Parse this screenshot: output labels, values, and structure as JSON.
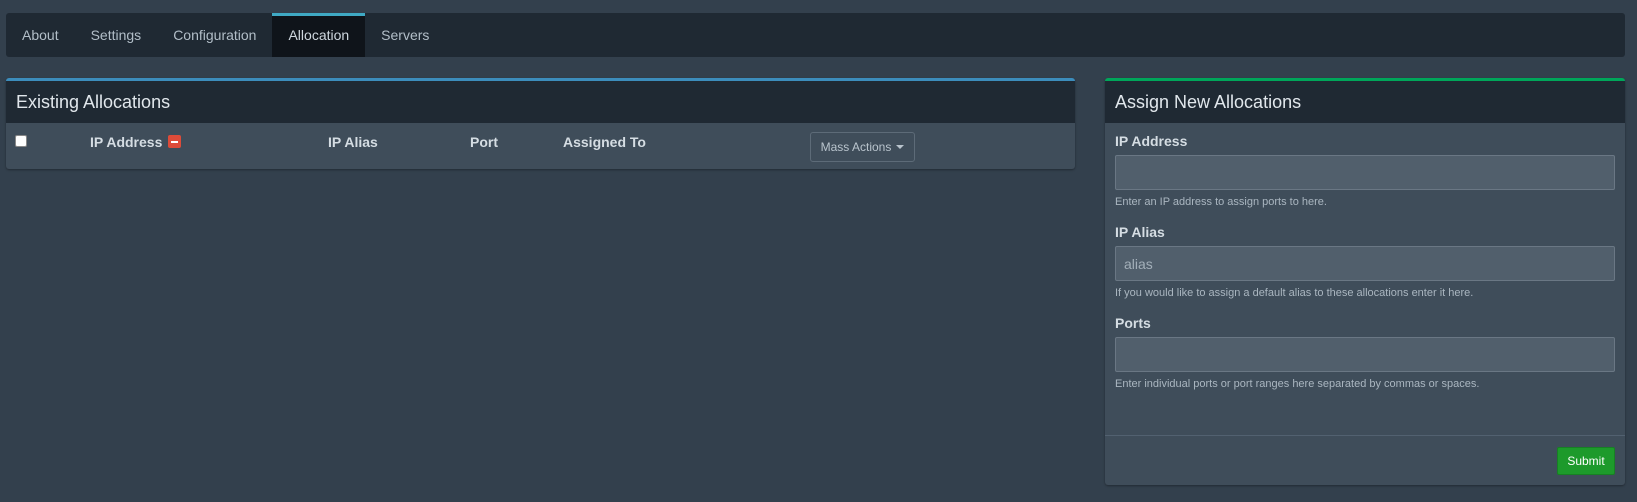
{
  "tabs": [
    {
      "label": "About"
    },
    {
      "label": "Settings"
    },
    {
      "label": "Configuration"
    },
    {
      "label": "Allocation",
      "active": true
    },
    {
      "label": "Servers"
    }
  ],
  "existing": {
    "title": "Existing Allocations",
    "columns": {
      "ip_address": "IP Address",
      "ip_alias": "IP Alias",
      "port": "Port",
      "assigned_to": "Assigned To"
    },
    "mass_actions_label": "Mass Actions",
    "rows": []
  },
  "assign": {
    "title": "Assign New Allocations",
    "ip_address": {
      "label": "IP Address",
      "value": "",
      "help": "Enter an IP address to assign ports to here."
    },
    "ip_alias": {
      "label": "IP Alias",
      "placeholder": "alias",
      "help": "If you would like to assign a default alias to these allocations enter it here."
    },
    "ports": {
      "label": "Ports",
      "value": "",
      "help": "Enter individual ports or port ranges here separated by commas or spaces."
    },
    "submit_label": "Submit"
  },
  "colors": {
    "background": "#33404d",
    "header": "#1f2933",
    "accent_blue": "#3c8dbc",
    "accent_green": "#00a65a",
    "active_tab_border": "#3fa9c4",
    "danger": "#dd4b39",
    "submit": "#1d9a2b"
  }
}
